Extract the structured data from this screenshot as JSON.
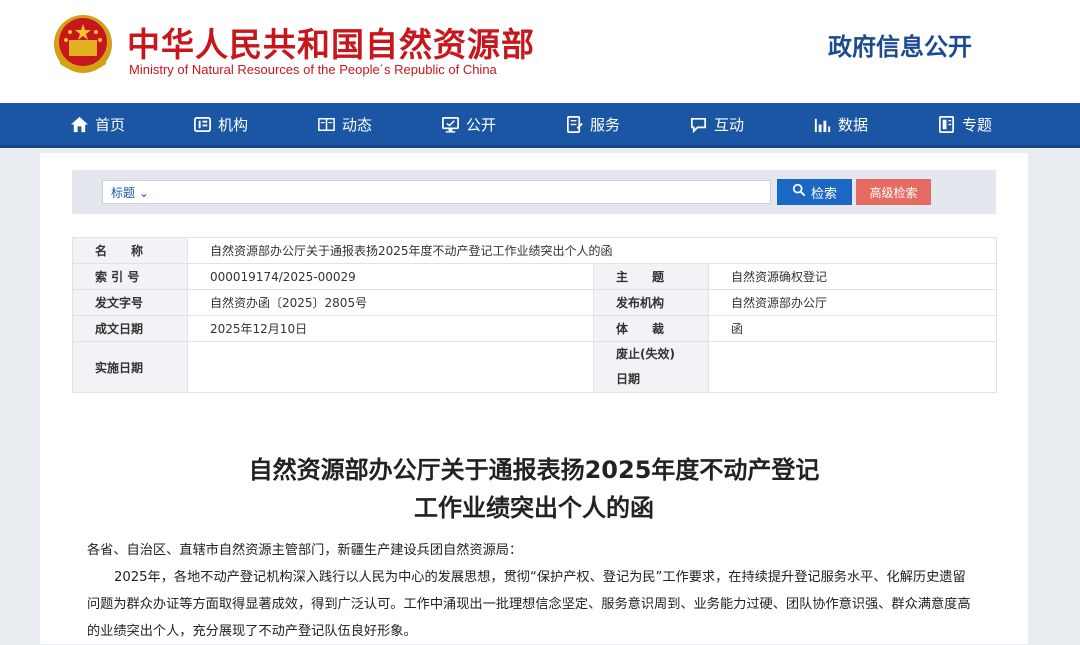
{
  "header": {
    "title": "中华人民共和国自然资源部",
    "subtitle": "Ministry of Natural Resources of the People´s Republic of China",
    "right_title": "政府信息公开"
  },
  "nav": [
    {
      "label": "首页",
      "icon": "home-icon"
    },
    {
      "label": "机构",
      "icon": "org-icon"
    },
    {
      "label": "动态",
      "icon": "news-icon"
    },
    {
      "label": "公开",
      "icon": "monitor-icon"
    },
    {
      "label": "服务",
      "icon": "service-icon"
    },
    {
      "label": "互动",
      "icon": "chat-icon"
    },
    {
      "label": "数据",
      "icon": "chart-icon"
    },
    {
      "label": "专题",
      "icon": "topic-icon"
    }
  ],
  "search": {
    "type_label": "标题",
    "search_label": "检索",
    "advanced_label": "高级检索"
  },
  "meta": {
    "name_label": "名　　称",
    "name_value": "自然资源部办公厅关于通报表扬2025年度不动产登记工作业绩突出个人的函",
    "index_label": "索 引 号",
    "index_value": "000019174/2025-00029",
    "topic_label": "主　　题",
    "topic_value": "自然资源确权登记",
    "doc_no_label": "发文字号",
    "doc_no_value": "自然资办函〔2025〕2805号",
    "issuer_label": "发布机构",
    "issuer_value": "自然资源部办公厅",
    "date_label": "成文日期",
    "date_value": "2025年12月10日",
    "genre_label": "体　　裁",
    "genre_value": "函",
    "effective_label": "实施日期",
    "effective_value": "",
    "expiry_label_1": "废止(失效)",
    "expiry_label_2": "日期",
    "expiry_value": ""
  },
  "document": {
    "title_line1": "自然资源部办公厅关于通报表扬2025年度不动产登记",
    "title_line2": "工作业绩突出个人的函",
    "salutation": "各省、自治区、直辖市自然资源主管部门，新疆生产建设兵团自然资源局：",
    "paragraph1_line1": "2025年，各地不动产登记机构深入践行以人民为中心的发展思想，贯彻“保护产权、登记为民”工作要求，在持续提升登记服务水平、化解历史遗留",
    "paragraph1_line2": "问题为群众办证等方面取得显著成效，得到广泛认可。工作中涌现出一批理想信念坚定、服务意识周到、业务能力过硬、团队协作意识强、群众满意度高",
    "paragraph1_line3": "的业绩突出个人，充分展现了不动产登记队伍良好形象。"
  },
  "colors": {
    "brand_red": "#c8161d",
    "nav_blue": "#1b56a4",
    "search_blue": "#1d67c4",
    "advanced_red": "#e66c63"
  }
}
